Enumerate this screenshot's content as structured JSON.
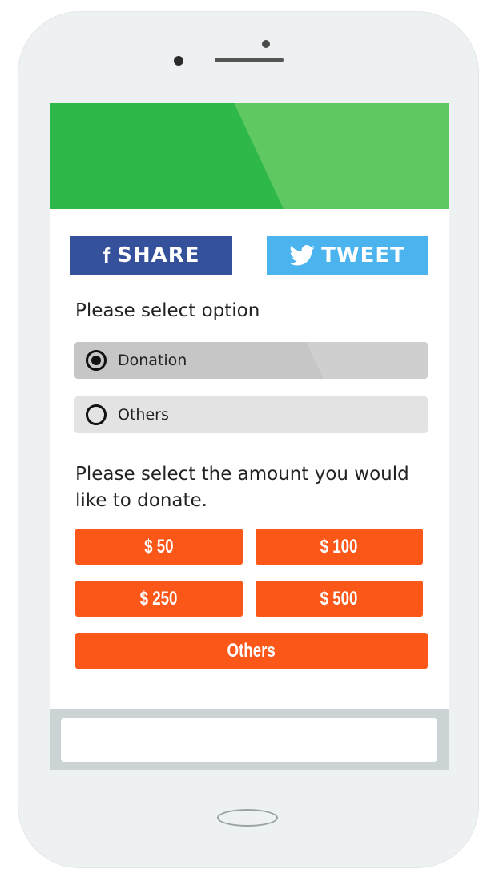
{
  "social": {
    "share_label": "SHARE",
    "share_icon": "f",
    "tweet_label": "TWEET"
  },
  "form": {
    "option_prompt": "Please select option",
    "options": [
      {
        "label": "Donation",
        "selected": true
      },
      {
        "label": "Others",
        "selected": false
      }
    ],
    "amount_prompt": "Please select the amount you would like to donate.",
    "amounts": [
      "$ 50",
      "$ 100",
      "$ 250",
      "$ 500"
    ],
    "other_amount_label": "Others"
  },
  "colors": {
    "hero": "#2eb84a",
    "share": "#36519c",
    "tweet": "#4bb4ee",
    "amount_button": "#fb5718"
  }
}
